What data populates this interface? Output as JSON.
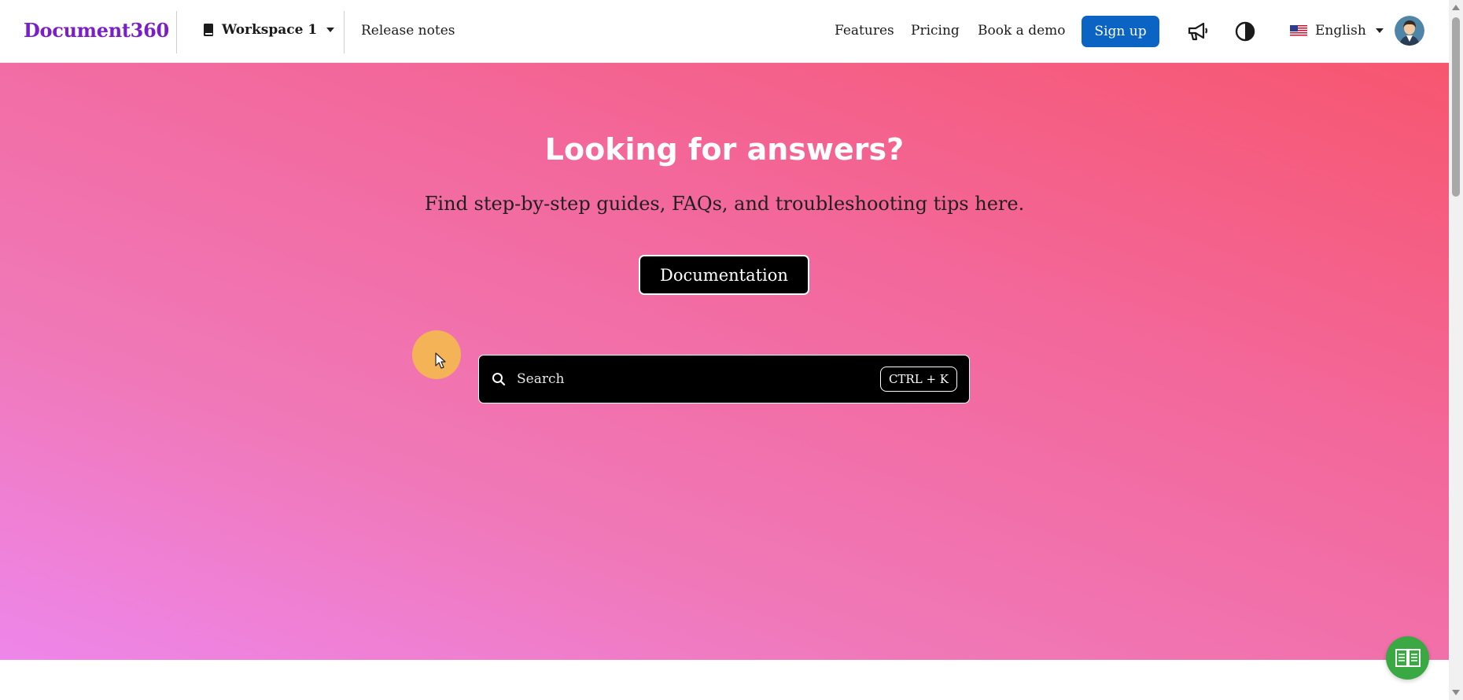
{
  "header": {
    "logo": "Document360",
    "workspace": {
      "label": "Workspace 1",
      "icon": "book-icon"
    },
    "release_notes": "Release notes",
    "nav": {
      "features": "Features",
      "pricing": "Pricing",
      "book_demo": "Book a demo"
    },
    "signup": "Sign up",
    "icons": {
      "announcements": "megaphone-icon",
      "theme": "contrast-icon"
    },
    "language": {
      "label": "English",
      "flag": "us-flag-icon"
    }
  },
  "hero": {
    "title": "Looking for answers?",
    "subtitle": "Find step-by-step guides, FAQs, and troubleshooting tips here.",
    "button": "Documentation",
    "search": {
      "placeholder": "Search",
      "shortcut": "CTRL + K"
    }
  },
  "colors": {
    "brand": "#7a1fc7",
    "primary_button": "#0b63c4",
    "hero_gradient": [
      "#f7566f",
      "#f3679a",
      "#f078b8",
      "#ee86ea"
    ],
    "help_button": "#3aa843"
  },
  "floating": {
    "help_icon": "open-book-icon"
  }
}
